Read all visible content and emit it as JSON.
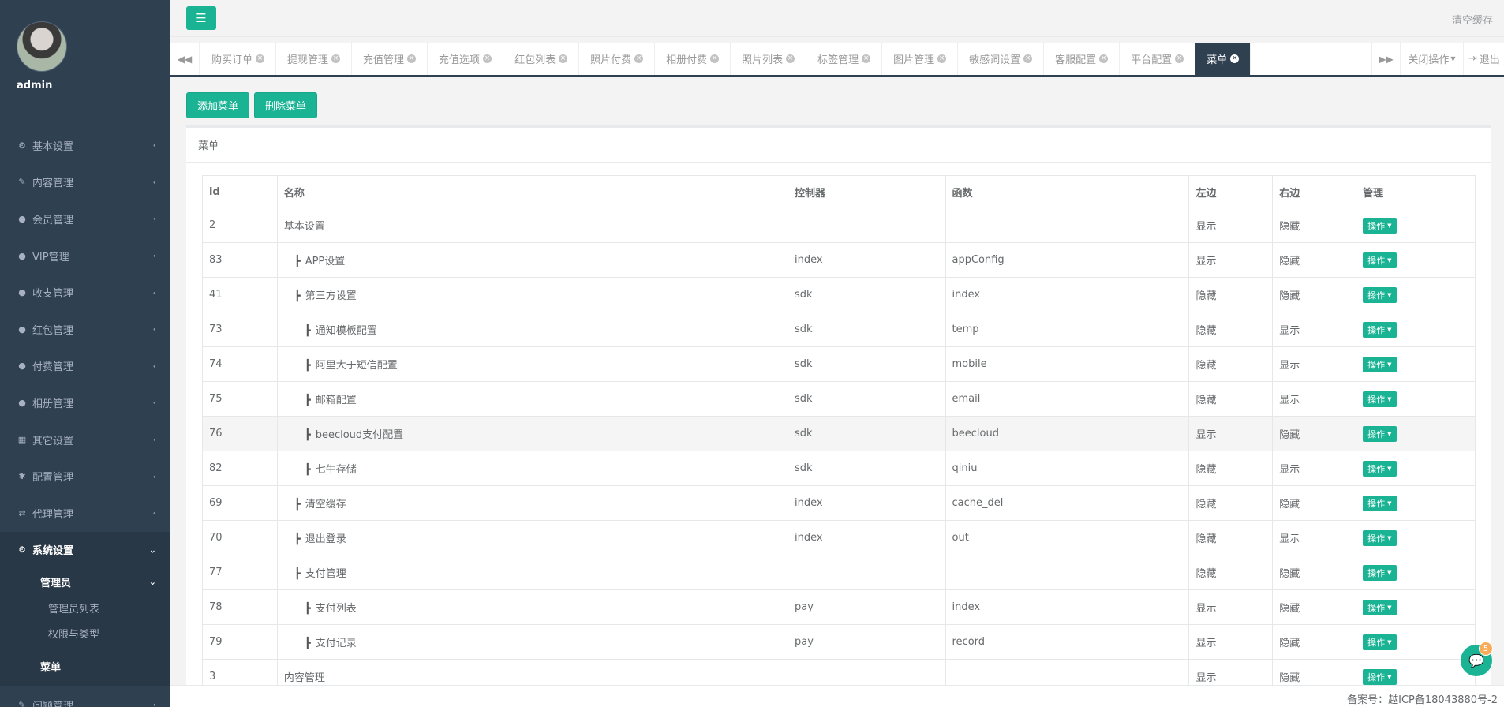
{
  "sidebar": {
    "username": "admin",
    "items": [
      {
        "label": "基本设置",
        "icon": "gear-icon"
      },
      {
        "label": "内容管理",
        "icon": "edit-icon"
      },
      {
        "label": "会员管理",
        "icon": "user-icon"
      },
      {
        "label": "VIP管理",
        "icon": "user-icon"
      },
      {
        "label": "收支管理",
        "icon": "user-icon"
      },
      {
        "label": "红包管理",
        "icon": "user-icon"
      },
      {
        "label": "付费管理",
        "icon": "user-icon"
      },
      {
        "label": "相册管理",
        "icon": "user-icon"
      },
      {
        "label": "其它设置",
        "icon": "table-icon"
      },
      {
        "label": "配置管理",
        "icon": "asterisk-icon"
      },
      {
        "label": "代理管理",
        "icon": "exchange-icon"
      }
    ],
    "active_item": {
      "label": "系统设置",
      "icon": "gears-icon"
    },
    "sub_group": "管理员",
    "sub_items": [
      "管理员列表",
      "权限与类型"
    ],
    "menu_item": "菜单",
    "next_item": {
      "label": "问题管理",
      "icon": "edit-icon"
    }
  },
  "topbar": {
    "toggle_icon": "menu-icon",
    "clear_cache": "清空缓存"
  },
  "tabs": {
    "items": [
      "购买订单",
      "提现管理",
      "充值管理",
      "充值选项",
      "红包列表",
      "照片付费",
      "相册付费",
      "照片列表",
      "标签管理",
      "图片管理",
      "敏感词设置",
      "客服配置",
      "平台配置"
    ],
    "active": "菜单",
    "close_ops": "关闭操作",
    "logout": "退出"
  },
  "actions": {
    "add": "添加菜单",
    "delete": "删除菜单"
  },
  "panel": {
    "title": "菜单"
  },
  "table": {
    "headers": [
      "id",
      "名称",
      "控制器",
      "函数",
      "左边",
      "右边",
      "管理"
    ],
    "op_label": "操作",
    "rows": [
      {
        "id": "2",
        "level": 0,
        "name": "基本设置",
        "controller": "",
        "func": "",
        "left": "显示",
        "right": "隐藏"
      },
      {
        "id": "83",
        "level": 1,
        "name": "APP设置",
        "controller": "index",
        "func": "appConfig",
        "left": "显示",
        "right": "隐藏"
      },
      {
        "id": "41",
        "level": 1,
        "name": "第三方设置",
        "controller": "sdk",
        "func": "index",
        "left": "隐藏",
        "right": "隐藏"
      },
      {
        "id": "73",
        "level": 2,
        "name": "通知模板配置",
        "controller": "sdk",
        "func": "temp",
        "left": "隐藏",
        "right": "显示"
      },
      {
        "id": "74",
        "level": 2,
        "name": "阿里大于短信配置",
        "controller": "sdk",
        "func": "mobile",
        "left": "隐藏",
        "right": "显示"
      },
      {
        "id": "75",
        "level": 2,
        "name": "邮箱配置",
        "controller": "sdk",
        "func": "email",
        "left": "隐藏",
        "right": "显示"
      },
      {
        "id": "76",
        "level": 2,
        "name": "beecloud支付配置",
        "controller": "sdk",
        "func": "beecloud",
        "left": "显示",
        "right": "隐藏"
      },
      {
        "id": "82",
        "level": 2,
        "name": "七牛存储",
        "controller": "sdk",
        "func": "qiniu",
        "left": "隐藏",
        "right": "显示"
      },
      {
        "id": "69",
        "level": 1,
        "name": "清空缓存",
        "controller": "index",
        "func": "cache_del",
        "left": "隐藏",
        "right": "隐藏"
      },
      {
        "id": "70",
        "level": 1,
        "name": "退出登录",
        "controller": "index",
        "func": "out",
        "left": "隐藏",
        "right": "显示"
      },
      {
        "id": "77",
        "level": 1,
        "name": "支付管理",
        "controller": "",
        "func": "",
        "left": "隐藏",
        "right": "隐藏"
      },
      {
        "id": "78",
        "level": 2,
        "name": "支付列表",
        "controller": "pay",
        "func": "index",
        "left": "显示",
        "right": "隐藏"
      },
      {
        "id": "79",
        "level": 2,
        "name": "支付记录",
        "controller": "pay",
        "func": "record",
        "left": "显示",
        "right": "隐藏"
      },
      {
        "id": "3",
        "level": 0,
        "name": "内容管理",
        "controller": "",
        "func": "",
        "left": "显示",
        "right": "隐藏"
      }
    ],
    "highlight_id": "76"
  },
  "footer": {
    "text": "备案号：越ICP备18043880号-2"
  },
  "chat": {
    "badge": "5"
  }
}
